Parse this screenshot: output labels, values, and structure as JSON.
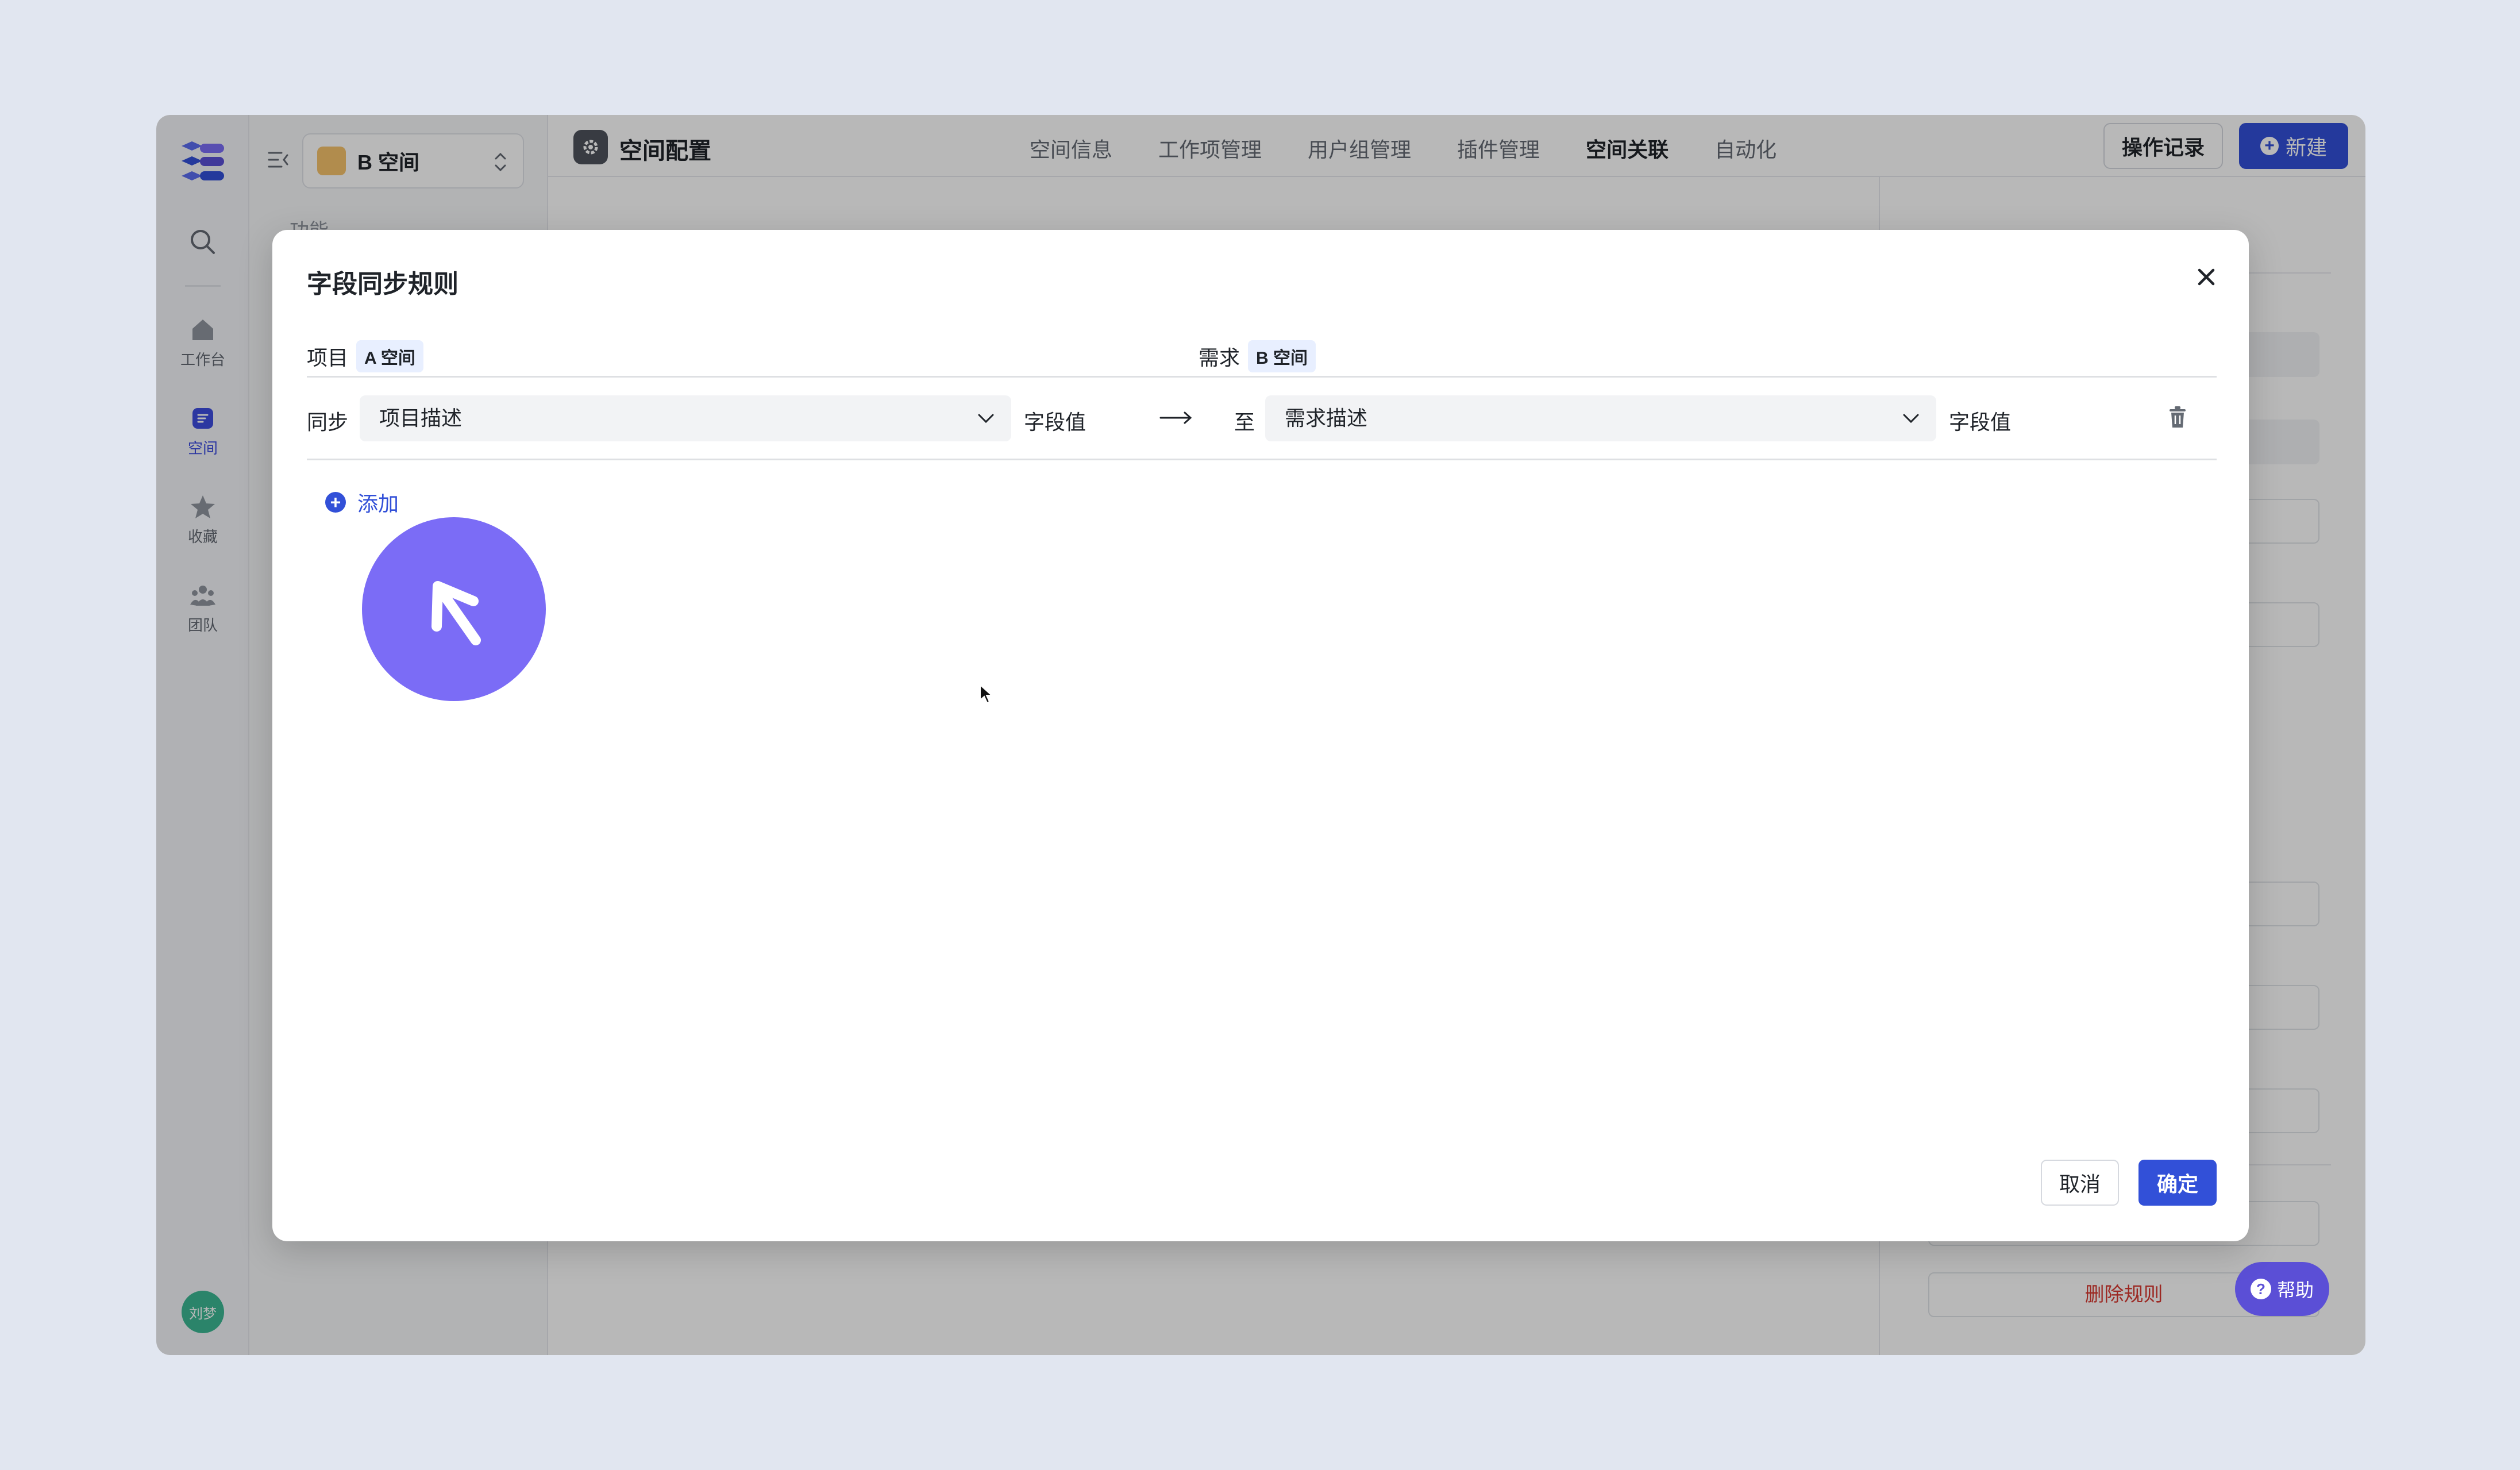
{
  "rail": {
    "items": [
      {
        "label": "工作台",
        "icon": "home-icon"
      },
      {
        "label": "空间",
        "icon": "space-icon"
      },
      {
        "label": "收藏",
        "icon": "star-icon"
      },
      {
        "label": "团队",
        "icon": "team-icon"
      }
    ],
    "avatar": "刘梦"
  },
  "sidebar": {
    "space_name": "B 空间",
    "section_label": "功能"
  },
  "header": {
    "title": "空间配置",
    "tabs": [
      "空间信息",
      "工作项管理",
      "用户组管理",
      "插件管理",
      "空间关联",
      "自动化"
    ],
    "active_tab": "空间关联",
    "record_button": "操作记录",
    "new_button": "新建"
  },
  "right_panel": {
    "delete_rule": "删除规则"
  },
  "help": {
    "label": "帮助"
  },
  "modal": {
    "title": "字段同步规则",
    "source": {
      "label": "项目",
      "tag": "A 空间"
    },
    "target": {
      "label": "需求",
      "tag": "B 空间"
    },
    "rule": {
      "sync_label": "同步",
      "source_field": "项目描述",
      "source_value_label": "字段值",
      "to_label": "至",
      "target_field": "需求描述",
      "target_value_label": "字段值"
    },
    "add_label": "添加",
    "cancel": "取消",
    "confirm": "确定"
  },
  "colors": {
    "primary": "#3250d8",
    "cursor_bubble": "#7b6cf6",
    "danger": "#d83931",
    "tag_bg": "#e8efff"
  }
}
